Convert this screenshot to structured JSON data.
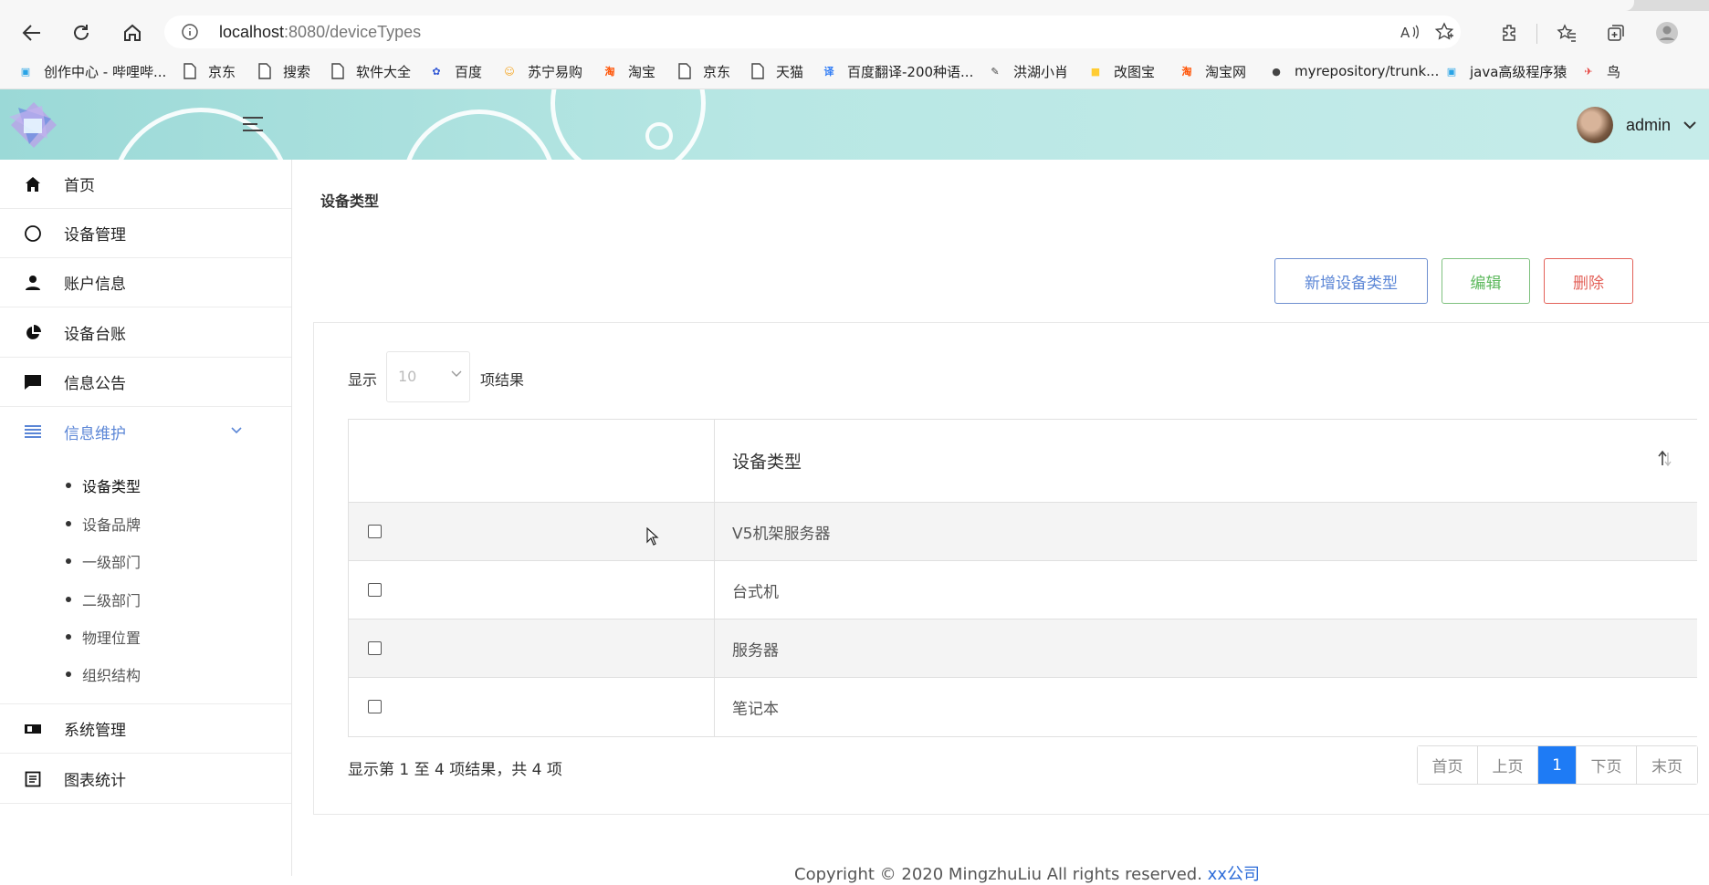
{
  "browser": {
    "url_host": "localhost",
    "url_path": ":8080/deviceTypes",
    "bookmarks": [
      {
        "label": "创作中心 - 哔哩哔...",
        "icon": "bilibili-icon",
        "color": "#2aa4e6"
      },
      {
        "label": "京东",
        "icon": "page-icon"
      },
      {
        "label": "搜索",
        "icon": "page-icon"
      },
      {
        "label": "软件大全",
        "icon": "page-icon"
      },
      {
        "label": "百度",
        "icon": "baidu-icon",
        "color": "#2f55d4"
      },
      {
        "label": "苏宁易购",
        "icon": "suning-icon",
        "color": "#f5a623"
      },
      {
        "label": "淘宝",
        "icon": "taobao-icon",
        "color": "#ff5000"
      },
      {
        "label": "京东",
        "icon": "page-icon"
      },
      {
        "label": "天猫",
        "icon": "page-icon"
      },
      {
        "label": "百度翻译-200种语...",
        "icon": "translate-icon",
        "color": "#2f7cf6"
      },
      {
        "label": "洪湖小肖",
        "icon": "bird-icon"
      },
      {
        "label": "改图宝",
        "icon": "gaitubao-icon",
        "color": "#ffcc33"
      },
      {
        "label": "淘宝网",
        "icon": "taobao-icon",
        "color": "#ff5000"
      },
      {
        "label": "myrepository/trunk...",
        "icon": "chrome-icon"
      },
      {
        "label": "java高级程序猿",
        "icon": "bilibili-icon",
        "color": "#2aa4e6"
      },
      {
        "label": "鸟",
        "icon": "bird-red-icon",
        "color": "#e53935"
      }
    ]
  },
  "header": {
    "username": "admin"
  },
  "sidebar": {
    "items": [
      {
        "label": "首页",
        "icon": "home-icon"
      },
      {
        "label": "设备管理",
        "icon": "circle-icon"
      },
      {
        "label": "账户信息",
        "icon": "user-icon"
      },
      {
        "label": "设备台账",
        "icon": "pie-chart-icon"
      },
      {
        "label": "信息公告",
        "icon": "message-icon"
      },
      {
        "label": "信息维护",
        "icon": "list-icon",
        "active": true
      },
      {
        "label": "系统管理",
        "icon": "card-icon"
      },
      {
        "label": "图表统计",
        "icon": "document-icon"
      }
    ],
    "submenu": [
      "设备类型",
      "设备品牌",
      "一级部门",
      "二级部门",
      "物理位置",
      "组织结构"
    ],
    "accent_color": "#5b86d6"
  },
  "main": {
    "title": "设备类型",
    "buttons": {
      "add": "新增设备类型",
      "edit": "编辑",
      "delete": "删除"
    },
    "length_menu": {
      "prefix": "显示",
      "value": "10",
      "suffix": "项结果"
    },
    "table": {
      "column": "设备类型",
      "rows": [
        "V5机架服务器",
        "台式机",
        "服务器",
        "笔记本"
      ]
    },
    "info": "显示第 1 至 4 项结果，共 4 项",
    "pager": {
      "first": "首页",
      "prev": "上页",
      "current": "1",
      "next": "下页",
      "last": "末页"
    },
    "footer": {
      "text": "Copyright © 2020 MingzhuLiu All rights reserved. ",
      "link": "xx公司"
    }
  }
}
